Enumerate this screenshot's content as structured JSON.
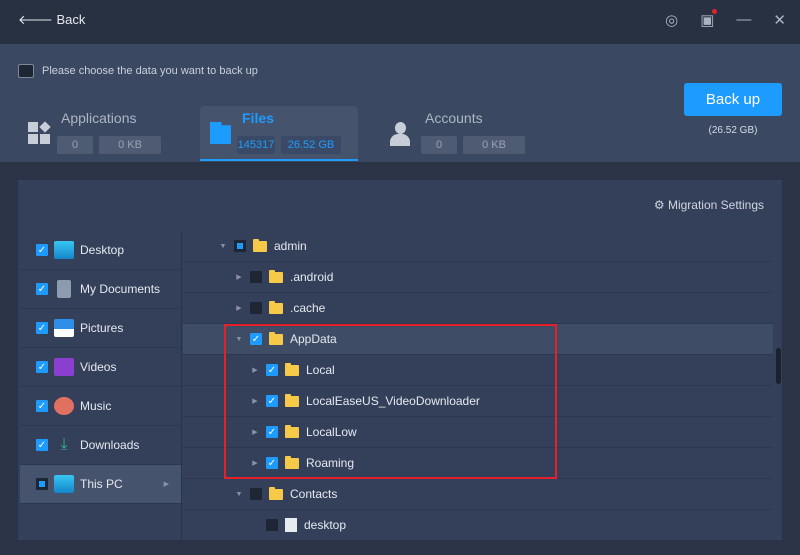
{
  "titlebar": {
    "back_label": "Back"
  },
  "header": {
    "hint": "Please choose the data you want to back up",
    "tabs": [
      {
        "name": "Applications",
        "count": "0",
        "size": "0 KB"
      },
      {
        "name": "Files",
        "count": "145317",
        "size": "26.52 GB"
      },
      {
        "name": "Accounts",
        "count": "0",
        "size": "0 KB"
      }
    ],
    "backup_label": "Back up",
    "backup_size": "(26.52 GB)"
  },
  "panel": {
    "migration_settings": "Migration Settings",
    "sidebar": [
      {
        "label": "Desktop",
        "state": "checked"
      },
      {
        "label": "My Documents",
        "state": "checked"
      },
      {
        "label": "Pictures",
        "state": "checked"
      },
      {
        "label": "Videos",
        "state": "checked"
      },
      {
        "label": "Music",
        "state": "checked"
      },
      {
        "label": "Downloads",
        "state": "checked"
      },
      {
        "label": "This PC",
        "state": "partial"
      }
    ],
    "tree": [
      {
        "label": "admin"
      },
      {
        "label": ".android"
      },
      {
        "label": ".cache"
      },
      {
        "label": "AppData"
      },
      {
        "label": "Local"
      },
      {
        "label": "LocalEaseUS_VideoDownloader"
      },
      {
        "label": "LocalLow"
      },
      {
        "label": "Roaming"
      },
      {
        "label": "Contacts"
      },
      {
        "label": "desktop"
      }
    ]
  },
  "colors": {
    "accent": "#1e9bff",
    "highlight": "#e5202a"
  }
}
